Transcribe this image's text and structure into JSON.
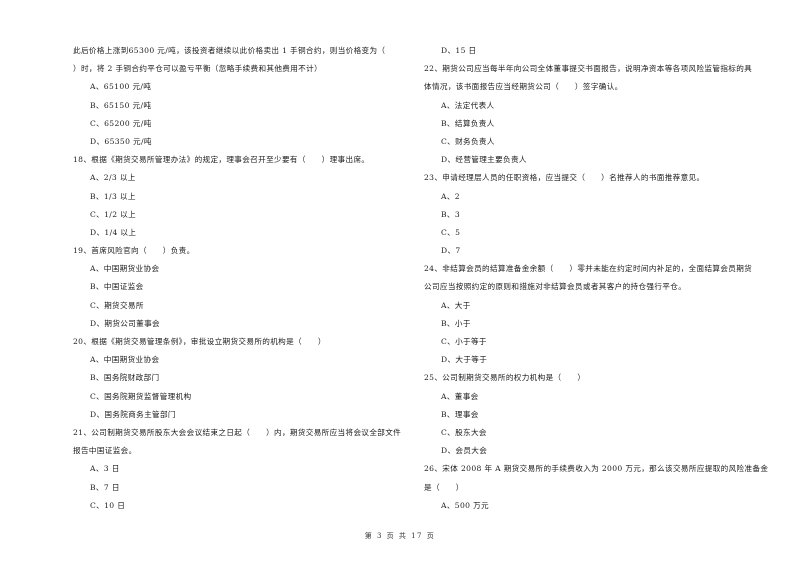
{
  "left_column": {
    "q17_cont": {
      "lines": [
        "此后价格上涨到65300 元/吨，该投资者继续以此价格卖出 1 手铜合约，则当价格变为（",
        "）时，将 2 手铜合约平仓可以盈亏平衡（忽略手续费和其他费用不计）"
      ],
      "options": [
        "A、65100 元/吨",
        "B、65150 元/吨",
        "C、65200 元/吨",
        "D、65350 元/吨"
      ]
    },
    "q18": {
      "lines": [
        "18、根据《期货交易所管理办法》的规定，理事会召开至少要有（　　）理事出席。"
      ],
      "options": [
        "A、2/3 以上",
        "B、1/3 以上",
        "C、1/2 以上",
        "D、1/4 以上"
      ]
    },
    "q19": {
      "lines": [
        "19、首席风险官向（　　）负责。"
      ],
      "options": [
        "A、中国期货业协会",
        "B、中国证监会",
        "C、期货交易所",
        "D、期货公司董事会"
      ]
    },
    "q20": {
      "lines": [
        "20、根据《期货交易管理条例》，审批设立期货交易所的机构是（　　）"
      ],
      "options": [
        "A、中国期货业协会",
        "B、国务院财政部门",
        "C、国务院期货监督管理机构",
        "D、国务院商务主管部门"
      ]
    },
    "q21": {
      "lines": [
        "21、公司制期货交易所股东大会会议结束之日起（　　）内，期货交易所应当将会议全部文件",
        "报告中国证监会。"
      ],
      "options": [
        "A、3 日",
        "B、7 日",
        "C、10 日"
      ]
    }
  },
  "right_column": {
    "q21_cont": {
      "options": [
        "D、15 日"
      ]
    },
    "q22": {
      "lines": [
        "22、期货公司应当每半年向公司全体董事提交书面报告，说明净资本等各项风险监管指标的具",
        "体情况，该书面报告应当经期货公司（　　）签字确认。"
      ],
      "options": [
        "A、法定代表人",
        "B、结算负责人",
        "C、财务负责人",
        "D、经营管理主要负责人"
      ]
    },
    "q23": {
      "lines": [
        "23、申请经理层人员的任职资格，应当提交（　　）名推荐人的书面推荐意见。"
      ],
      "options": [
        "A、2",
        "B、3",
        "C、5",
        "D、7"
      ]
    },
    "q24": {
      "lines": [
        "24、非结算会员的结算准备金余额（　　）零并未能在约定时间内补足的，全面结算会员期货",
        "公司应当按照约定的原则和措施对非结算会员或者其客户的持仓强行平仓。"
      ],
      "options": [
        "A、大于",
        "B、小于",
        "C、小于等于",
        "D、大于等于"
      ]
    },
    "q25": {
      "lines": [
        "25、公司制期货交易所的权力机构是（　　）"
      ],
      "options": [
        "A、董事会",
        "B、理事会",
        "C、股东大会",
        "D、会员大会"
      ]
    },
    "q26": {
      "lines": [
        "26、宋体 2008 年 A 期货交易所的手续费收入为 2000 万元，那么该交易所应提取的风险准备金",
        "是（　　）"
      ],
      "options": [
        "A、500 万元"
      ]
    }
  },
  "footer": {
    "page_label": "第 3 页 共 17 页"
  }
}
